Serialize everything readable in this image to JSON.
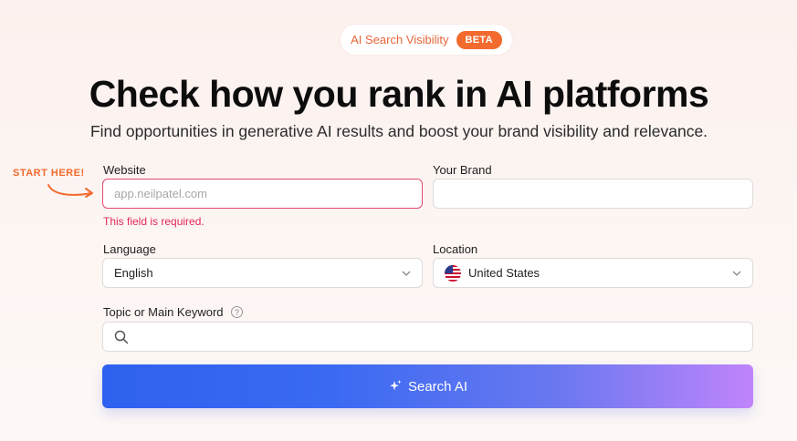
{
  "badge": {
    "label": "AI Search Visibility",
    "pill": "BETA"
  },
  "hero": {
    "title": "Check how you rank in AI platforms",
    "subtitle": "Find opportunities in generative AI results and boost your brand visibility and relevance."
  },
  "callout": {
    "text": "START HERE!"
  },
  "form": {
    "website": {
      "label": "Website",
      "placeholder": "app.neilpatel.com",
      "value": "",
      "error": "This field is required."
    },
    "brand": {
      "label": "Your Brand",
      "value": ""
    },
    "language": {
      "label": "Language",
      "value": "English"
    },
    "location": {
      "label": "Location",
      "value": "United States"
    },
    "keyword": {
      "label": "Topic or Main Keyword",
      "help": "?",
      "value": ""
    }
  },
  "submit": {
    "label": "Search AI"
  },
  "colors": {
    "accent": "#f26a2e",
    "error": "#e0285a",
    "button_start": "#2f61f0",
    "button_end": "#c084fb"
  }
}
